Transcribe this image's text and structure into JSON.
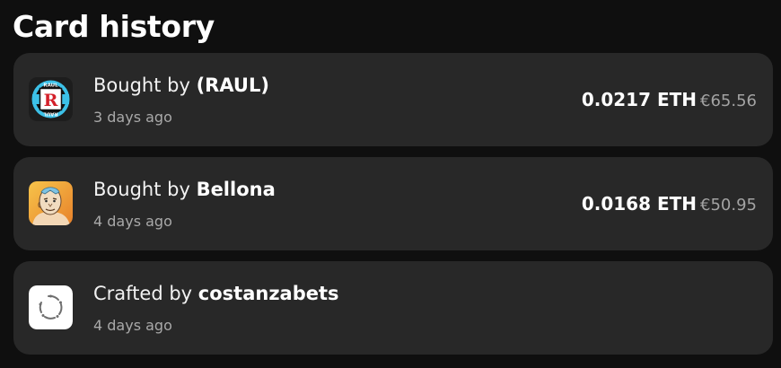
{
  "page": {
    "title": "Card history"
  },
  "history": [
    {
      "action": "Bought by",
      "user": "(RAUL)",
      "time": "3 days ago",
      "eth": "0.0217 ETH",
      "fiat": "€65.56",
      "icon": "raul-badge-icon",
      "badge_top": "RAUL",
      "badge_letter": "R",
      "badge_bottom": "RAUL"
    },
    {
      "action": "Bought by",
      "user": "Bellona",
      "time": "4 days ago",
      "eth": "0.0168 ETH",
      "fiat": "€50.95",
      "icon": "cartoon-avatar-icon"
    },
    {
      "action": "Crafted by",
      "user": "costanzabets",
      "time": "4 days ago",
      "icon": "craft-ring-icon"
    }
  ],
  "colors": {
    "background": "#0f0f0f",
    "card": "#282828",
    "muted": "#a9a9a9",
    "badge_red": "#d4202a",
    "badge_blue": "#3cc1e8"
  }
}
